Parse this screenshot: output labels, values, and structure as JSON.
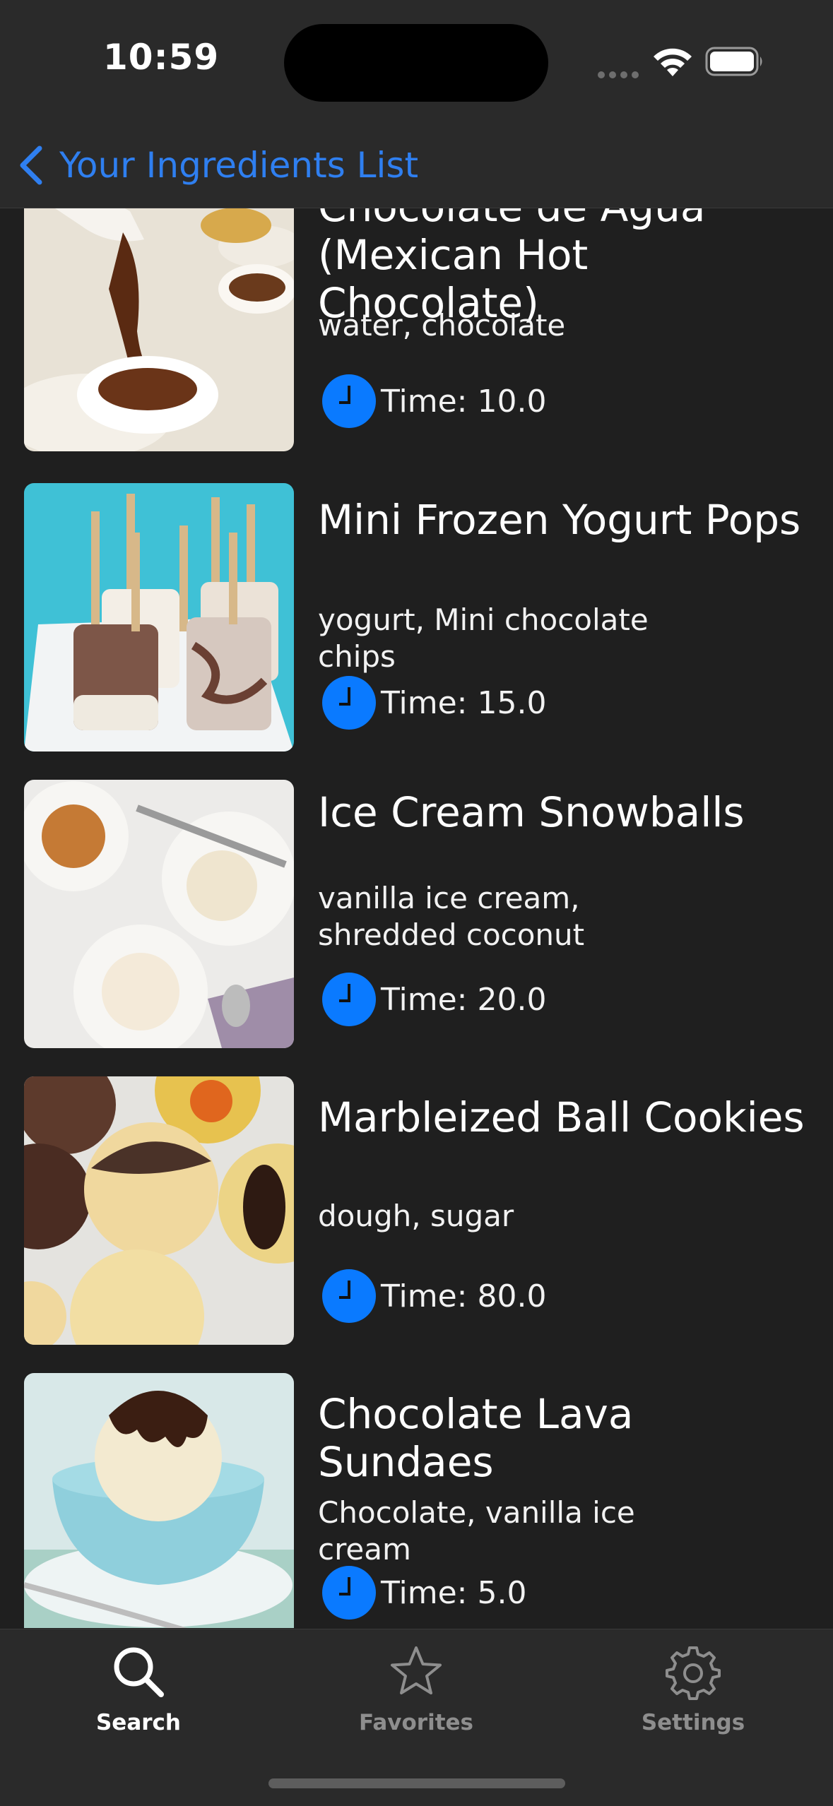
{
  "status_bar": {
    "time": "10:59"
  },
  "nav": {
    "back_label": "Your Ingredients List"
  },
  "recipes": [
    {
      "title": "Chocolate de Agua (Mexican Hot Chocolate)",
      "ingredients": "water, chocolate",
      "time": "Time: 10.0"
    },
    {
      "title": "Mini Frozen Yogurt Pops",
      "ingredients": "yogurt, Mini chocolate chips",
      "time": "Time: 15.0"
    },
    {
      "title": "Ice Cream Snowballs",
      "ingredients": "vanilla ice cream, shredded coconut",
      "time": "Time: 20.0"
    },
    {
      "title": "Marbleized Ball Cookies",
      "ingredients": "dough, sugar",
      "time": "Time: 80.0"
    },
    {
      "title": "Chocolate Lava Sundaes",
      "ingredients": "Chocolate, vanilla ice cream",
      "time": "Time: 5.0"
    }
  ],
  "tab_bar": {
    "items": [
      {
        "label": "Search",
        "icon": "search-icon",
        "active": true
      },
      {
        "label": "Favorites",
        "icon": "star-icon",
        "active": false
      },
      {
        "label": "Settings",
        "icon": "gear-icon",
        "active": false
      }
    ]
  },
  "colors": {
    "accent": "#2f7ff0",
    "clock": "#0a7aff",
    "background": "#1f1f1f",
    "bar": "#2a2a2a",
    "inactive_tab": "#8e8e8e"
  }
}
